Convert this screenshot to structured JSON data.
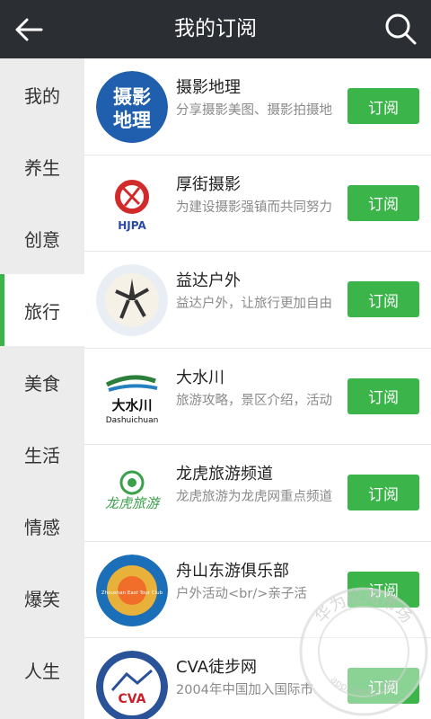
{
  "header": {
    "title": "我的订阅",
    "back_icon": "back-arrow-icon",
    "search_icon": "search-icon"
  },
  "sidebar": {
    "active_index": 3,
    "items": [
      {
        "label": "我的"
      },
      {
        "label": "养生"
      },
      {
        "label": "创意"
      },
      {
        "label": "旅行"
      },
      {
        "label": "美食"
      },
      {
        "label": "生活"
      },
      {
        "label": "情感"
      },
      {
        "label": "爆笑"
      },
      {
        "label": "人生"
      }
    ]
  },
  "subscriptions": [
    {
      "name": "摄影地理",
      "desc": "分享摄影美图、摄影拍摄地",
      "button": "订阅",
      "logo_text_1": "摄影",
      "logo_text_2": "地理"
    },
    {
      "name": "厚街摄影",
      "desc": "为建设摄影强镇而共同努力",
      "button": "订阅",
      "logo_text": "HJPA"
    },
    {
      "name": "益达户外",
      "desc": "益达户外，让旅行更加自由",
      "button": "订阅"
    },
    {
      "name": "大水川",
      "desc": "旅游攻略，景区介绍，活动",
      "button": "订阅",
      "logo_text_1": "大水川",
      "logo_text_2": "Dashuichuan"
    },
    {
      "name": "龙虎旅游频道",
      "desc": "龙虎旅游为龙虎网重点频道",
      "button": "订阅",
      "logo_text": "龙虎旅游"
    },
    {
      "name": "舟山东游俱乐部",
      "desc": "户外活动<br/>亲子活",
      "button": "订阅",
      "logo_text": "Zhoushan East Tour Club"
    },
    {
      "name": "CVA徒步网",
      "desc": "2004年中国加入国际市",
      "button": "订阅",
      "logo_text": "CVA"
    }
  ],
  "watermark": {
    "text_top": "华为应用市场",
    "text_bottom": "app.hiwall.com"
  },
  "colors": {
    "topbar": "#2b2e33",
    "accent": "#3bb54a",
    "sidebar_bg": "#ececec"
  }
}
